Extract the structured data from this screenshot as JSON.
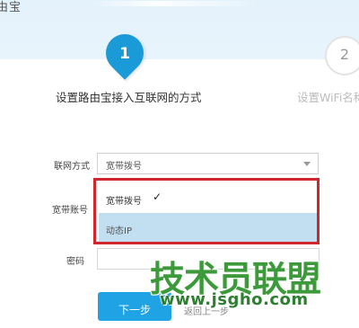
{
  "header": {
    "title": "由宝"
  },
  "steps": [
    {
      "number": "1",
      "label": "设置路由宝接入互联网的方式",
      "active": true
    },
    {
      "number": "2",
      "label": "设置WiFi名称",
      "active": false
    }
  ],
  "form": {
    "connection_type": {
      "label": "联网方式",
      "value": "宽带拨号"
    },
    "dropdown_options": [
      {
        "label": "宽带拨号",
        "selected": true,
        "check_mark": "✓"
      },
      {
        "label": "动态IP",
        "selected": false
      }
    ],
    "account_label": "宽带账号",
    "password_label": "密码",
    "next_button": "下一步",
    "prev_link": "返回上一步"
  },
  "watermark": {
    "text": "技术员联盟",
    "url": "www.jsgho.com"
  },
  "colors": {
    "primary": "#1a9bd8",
    "highlight_border": "#d0262c",
    "hover_option": "#c1dff1",
    "watermark_green": "#3d9a3a"
  }
}
